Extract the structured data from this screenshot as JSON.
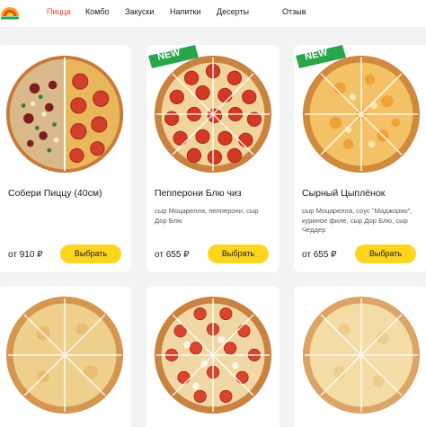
{
  "nav": {
    "items": [
      {
        "label": "Пицца",
        "active": true
      },
      {
        "label": "Комбо"
      },
      {
        "label": "Закуски"
      },
      {
        "label": "Напитки"
      },
      {
        "label": "Десерты"
      },
      {
        "label": "Отзыв"
      }
    ]
  },
  "colors": {
    "accent": "#e8452c",
    "button": "#ffd51f",
    "badge": "#2aa64a"
  },
  "products": [
    {
      "title": "Собери Пиццу (40см)",
      "description": "",
      "price": "от 910 ₽",
      "button": "Выбрать",
      "badge": "",
      "pizza": "half-half"
    },
    {
      "title": "Пепперони Блю чиз",
      "description": "сыр Моцарелла, пепперони, сыр Дор Блю",
      "price": "от 655 ₽",
      "button": "Выбрать",
      "badge": "NEW",
      "pizza": "pepperoni"
    },
    {
      "title": "Сырный Цыплёнок",
      "description": "сыр Моцарелла, соус \"Маджорио\", куриное филе, сыр Дор Блю, сыр Чеддер",
      "price": "от 655 ₽",
      "button": "Выбрать",
      "badge": "NEW",
      "pizza": "chicken"
    },
    {
      "title": "",
      "description": "",
      "price": "",
      "button": "",
      "badge": "",
      "pizza": "cheese"
    },
    {
      "title": "",
      "description": "",
      "price": "",
      "button": "",
      "badge": "",
      "pizza": "pepperoni-cheese"
    },
    {
      "title": "",
      "description": "",
      "price": "",
      "button": "",
      "badge": "",
      "pizza": "plain-cheese"
    }
  ]
}
